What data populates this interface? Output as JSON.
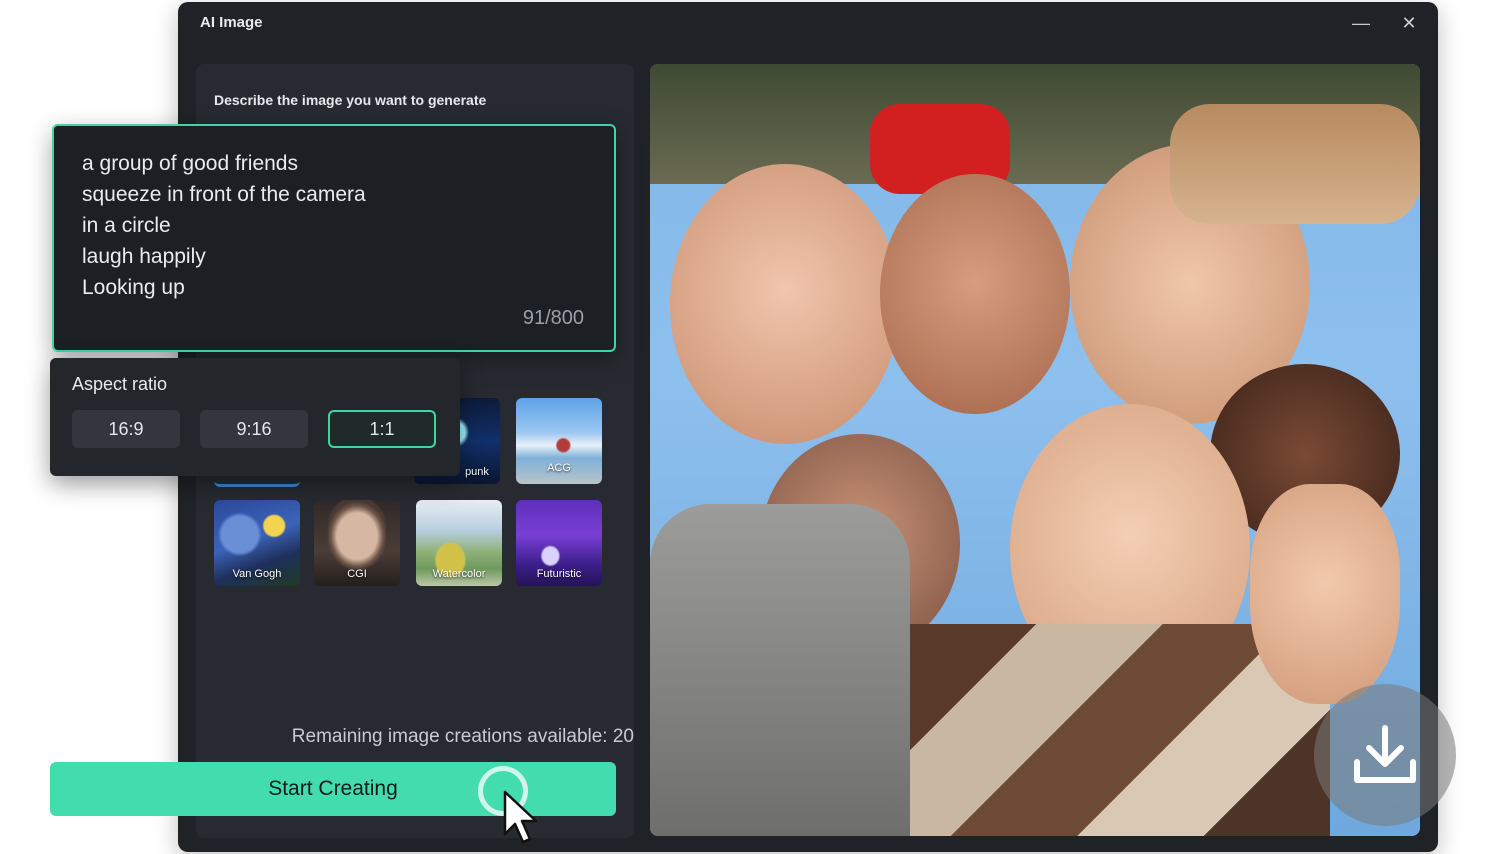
{
  "window": {
    "title": "AI Image",
    "minimize_glyph": "—",
    "close_glyph": "✕"
  },
  "left_panel": {
    "describe_label": "Describe the image you want to generate",
    "remaining_text": "Remaining image creations available: 20"
  },
  "prompt": {
    "lines": [
      "a group of good friends",
      "squeeze in front of the camera",
      "in a circle",
      "laugh happily",
      "Looking up"
    ],
    "counter": "91/800"
  },
  "aspect_ratio": {
    "title": "Aspect ratio",
    "options": [
      "16:9",
      "9:16",
      "1:1"
    ],
    "selected": "1:1"
  },
  "styles": [
    {
      "label": "punk"
    },
    {
      "label": "ACG"
    },
    {
      "label": "Van Gogh"
    },
    {
      "label": "CGI"
    },
    {
      "label": "Watercolor"
    },
    {
      "label": "Futuristic"
    }
  ],
  "start_button": {
    "label": "Start Creating"
  },
  "icons": {
    "download": "download-icon",
    "cursor": "mouse-pointer-icon"
  },
  "colors": {
    "accent": "#43dcae",
    "accent_border": "#3fd4a6",
    "window_bg": "#1f2227",
    "panel_bg": "#272a30"
  }
}
